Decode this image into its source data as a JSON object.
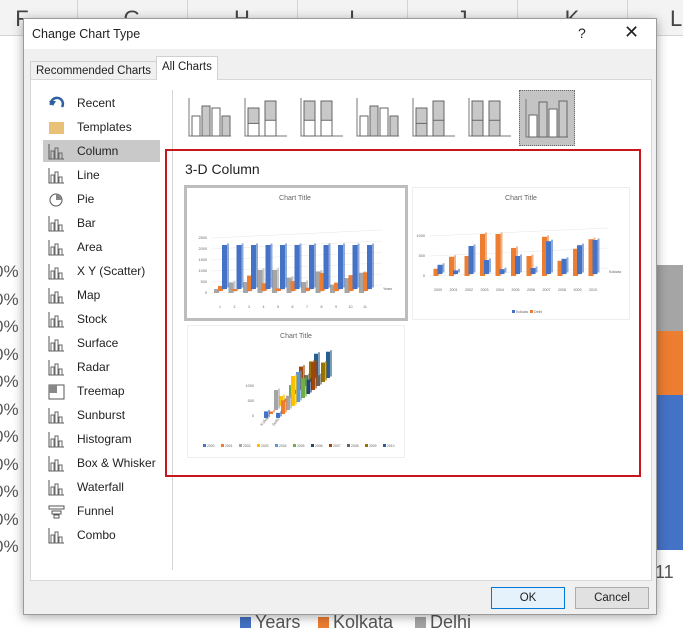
{
  "background": {
    "columns": [
      "F",
      "G",
      "H",
      "I",
      "J",
      "K",
      "L"
    ],
    "percent_labels": [
      "0%",
      "0%",
      "0%",
      "0%",
      "0%",
      "0%",
      "0%",
      "0%",
      "0%",
      "0%",
      "0%"
    ],
    "axis_label_right": "11",
    "legend": [
      {
        "label": "Years",
        "color": "#4472c4"
      },
      {
        "label": "Kolkata",
        "color": "#ed7d31"
      },
      {
        "label": "Delhi",
        "color": "#a5a5a5"
      }
    ]
  },
  "dialog": {
    "title": "Change Chart Type",
    "help_label": "?",
    "close_label": "✕",
    "tabs": [
      {
        "label": "Recommended Charts",
        "active": false
      },
      {
        "label": "All Charts",
        "active": true
      }
    ],
    "chart_types": [
      {
        "label": "Recent",
        "icon": "recent-icon"
      },
      {
        "label": "Templates",
        "icon": "folder-icon"
      },
      {
        "label": "Column",
        "icon": "column-chart-icon",
        "selected": true
      },
      {
        "label": "Line",
        "icon": "line-chart-icon"
      },
      {
        "label": "Pie",
        "icon": "pie-chart-icon"
      },
      {
        "label": "Bar",
        "icon": "bar-chart-icon"
      },
      {
        "label": "Area",
        "icon": "area-chart-icon"
      },
      {
        "label": "X Y (Scatter)",
        "icon": "scatter-chart-icon"
      },
      {
        "label": "Map",
        "icon": "map-icon"
      },
      {
        "label": "Stock",
        "icon": "stock-chart-icon"
      },
      {
        "label": "Surface",
        "icon": "surface-chart-icon"
      },
      {
        "label": "Radar",
        "icon": "radar-chart-icon"
      },
      {
        "label": "Treemap",
        "icon": "treemap-icon"
      },
      {
        "label": "Sunburst",
        "icon": "sunburst-icon"
      },
      {
        "label": "Histogram",
        "icon": "histogram-icon"
      },
      {
        "label": "Box & Whisker",
        "icon": "box-whisker-icon"
      },
      {
        "label": "Waterfall",
        "icon": "waterfall-icon"
      },
      {
        "label": "Funnel",
        "icon": "funnel-icon"
      },
      {
        "label": "Combo",
        "icon": "combo-chart-icon"
      }
    ],
    "subtypes": [
      "clustered-column",
      "stacked-column",
      "100-stacked-column",
      "3d-clustered-column",
      "3d-stacked-column",
      "3d-100-stacked-column",
      "3d-column"
    ],
    "selected_subtype": "3d-column",
    "section_title": "3-D Column",
    "previews": [
      {
        "title": "Chart Title",
        "yticks": [
          "2500",
          "2000",
          "1500",
          "1000",
          "500",
          "0"
        ],
        "xticks": [
          "1",
          "2",
          "3",
          "4",
          "5",
          "6",
          "7",
          "8",
          "9",
          "10",
          "11"
        ],
        "side_label": "Years",
        "legend": [
          "Years",
          "Kolkata",
          "Delhi"
        ]
      },
      {
        "title": "Chart Title",
        "yticks": [
          "1000",
          "500",
          "0"
        ],
        "xticks": [
          "2000",
          "2001",
          "2002",
          "2003",
          "2004",
          "2005",
          "2006",
          "2007",
          "2008",
          "2009",
          "2010"
        ],
        "side_label": "Kolkata",
        "legend": [
          "Kolkata",
          "Delhi"
        ]
      },
      {
        "title": "Chart Title",
        "yticks": [
          "1000",
          "500",
          "0"
        ],
        "cats": [
          "Kolkata",
          "Delhi"
        ],
        "legend": [
          "2000",
          "2001",
          "2002",
          "2003",
          "2004",
          "2005",
          "2006",
          "2007",
          "2008",
          "2009",
          "2010"
        ]
      }
    ],
    "series_values": {
      "Years": [
        2000,
        2000,
        2000,
        2000,
        2000,
        2000,
        2000,
        2000,
        2000,
        2000,
        2000
      ],
      "Kolkata": [
        230,
        90,
        700,
        350,
        120,
        450,
        150,
        820,
        380,
        720,
        850
      ],
      "Delhi": [
        180,
        480,
        500,
        1050,
        1050,
        700,
        500,
        980,
        380,
        680,
        920
      ]
    },
    "colors": {
      "blue": "#4472c4",
      "orange": "#ed7d31",
      "gray": "#a5a5a5",
      "accent_red": "#c8161d"
    },
    "ok_label": "OK",
    "cancel_label": "Cancel"
  }
}
